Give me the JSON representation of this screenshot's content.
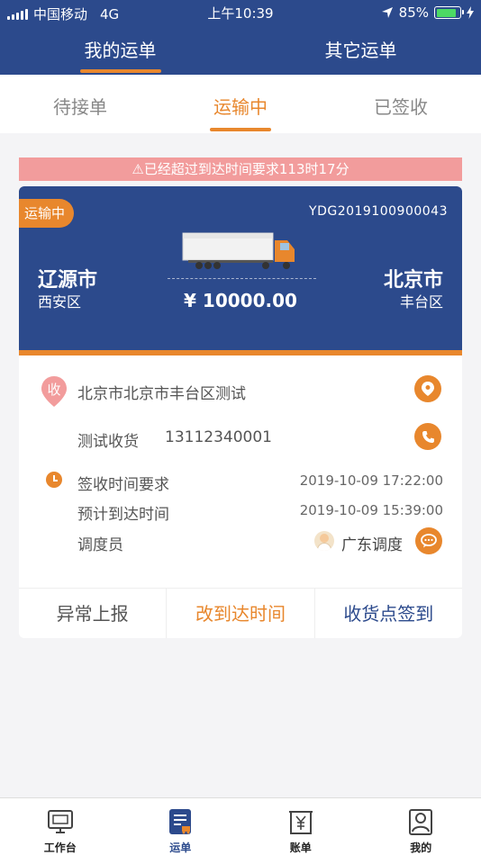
{
  "status_bar": {
    "carrier": "中国移动",
    "network": "4G",
    "time": "上午10:39",
    "battery": "85%"
  },
  "main_tabs": [
    {
      "label": "我的运单",
      "active": true
    },
    {
      "label": "其它运单",
      "active": false
    }
  ],
  "sub_tabs": [
    {
      "label": "待接单",
      "active": false
    },
    {
      "label": "运输中",
      "active": true
    },
    {
      "label": "已签收",
      "active": false
    }
  ],
  "warning": "⚠已经超过到达时间要求113时17分",
  "order": {
    "status": "运输中",
    "number": "YDG2019100900043",
    "from_city": "辽源市",
    "from_district": "西安区",
    "to_city": "北京市",
    "to_district": "丰台区",
    "price": "¥ 10000.00",
    "receive_badge": "收",
    "address": "北京市北京市丰台区测试",
    "receiver_name": "测试收货",
    "receiver_phone": "13112340001",
    "sign_time_label": "签收时间要求",
    "sign_time_value": "2019-10-09 17:22:00",
    "eta_label": "预计到达时间",
    "eta_value": "2019-10-09 15:39:00",
    "dispatcher_label": "调度员",
    "dispatcher_name": "广东调度"
  },
  "actions": {
    "report": "异常上报",
    "change_time": "改到达时间",
    "checkin": "收货点签到"
  },
  "bottom_nav": [
    {
      "label": "工作台",
      "icon": "monitor-icon",
      "active": false
    },
    {
      "label": "运单",
      "icon": "waybill-icon",
      "active": true
    },
    {
      "label": "账单",
      "icon": "bill-icon",
      "active": false
    },
    {
      "label": "我的",
      "icon": "profile-icon",
      "active": false
    }
  ],
  "colors": {
    "primary": "#2c4a8c",
    "accent": "#e8872d",
    "warning_bg": "#f29c9c"
  }
}
